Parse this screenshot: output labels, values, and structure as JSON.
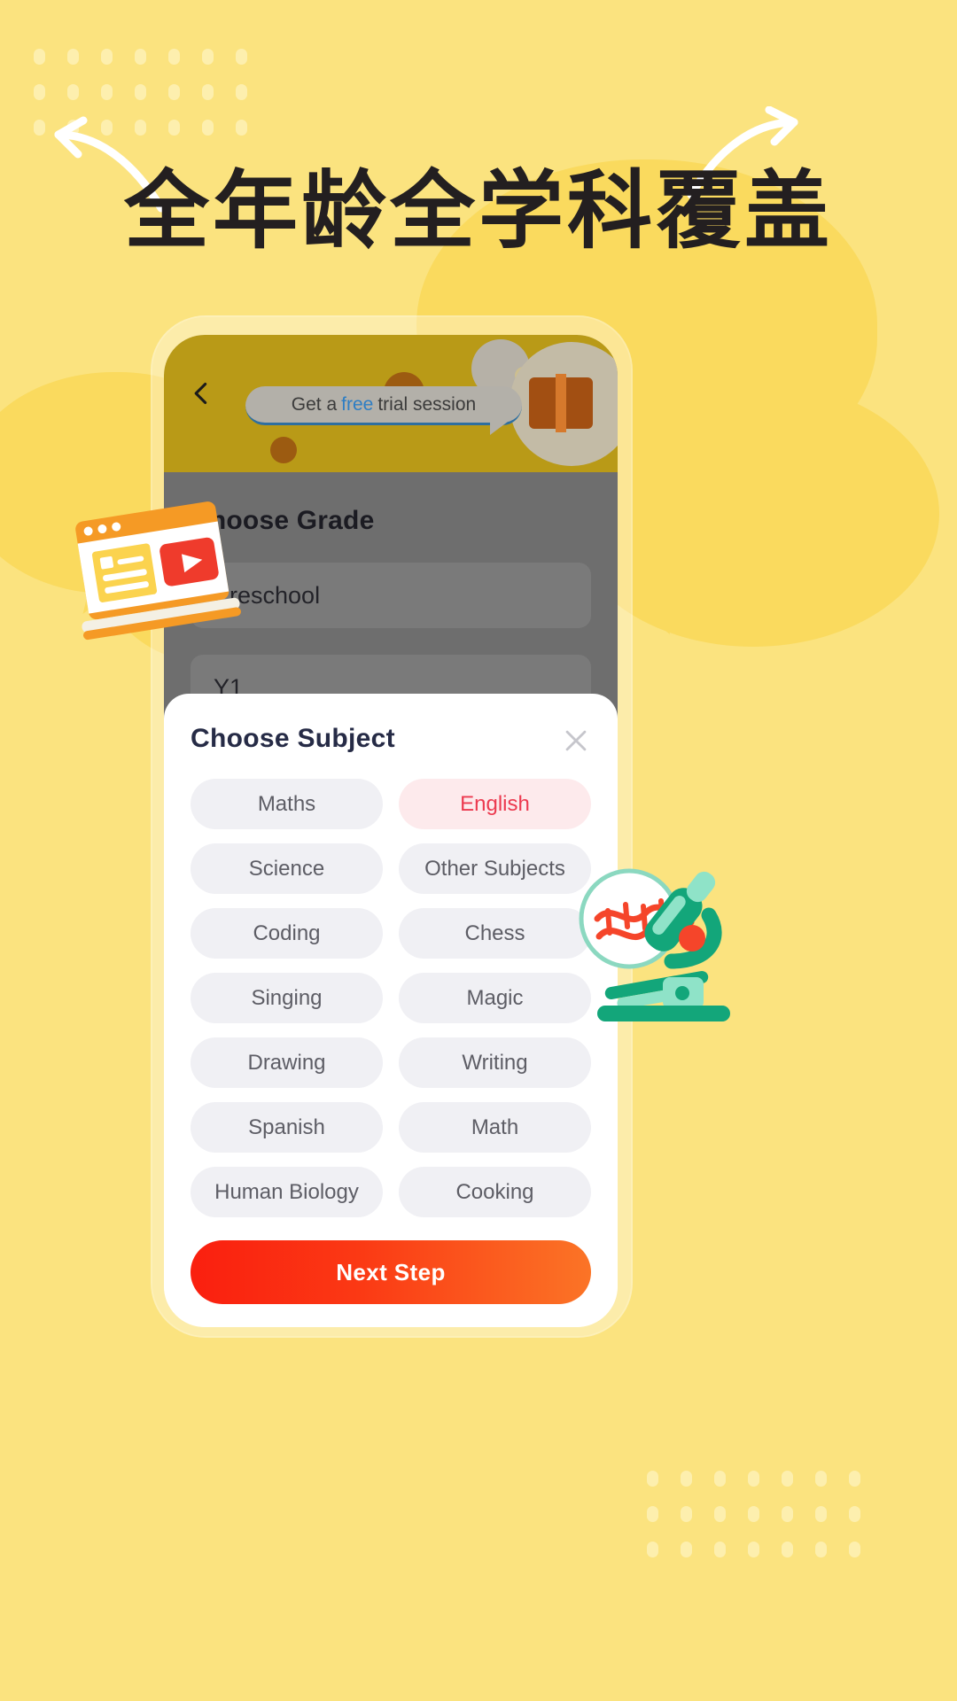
{
  "page": {
    "headline": "全年龄全学科覆盖",
    "background_color": "#fbe37f",
    "accent_color": "#ec3a4f"
  },
  "decor": {
    "arrow_left_name": "curved-arrow-left",
    "arrow_right_name": "curved-arrow-right",
    "laptop_illustration": "video-lesson-laptop-illustration",
    "microscope_illustration": "microscope-dna-illustration"
  },
  "app": {
    "header": {
      "back_icon": "back-chevron-icon",
      "bubble": {
        "prefix": "Get a ",
        "highlight": "free",
        "suffix": " trial session"
      },
      "gift_icon": "gift-icon"
    },
    "grade_section": {
      "title": "Choose Grade",
      "options": [
        "Preschool",
        "Y1"
      ]
    },
    "sheet": {
      "title": "Choose Subject",
      "close_icon": "close-icon",
      "subjects": [
        {
          "label": "Maths",
          "selected": false
        },
        {
          "label": "English",
          "selected": true
        },
        {
          "label": "Science",
          "selected": false
        },
        {
          "label": "Other Subjects",
          "selected": false
        },
        {
          "label": "Coding",
          "selected": false
        },
        {
          "label": "Chess",
          "selected": false
        },
        {
          "label": "Singing",
          "selected": false
        },
        {
          "label": "Magic",
          "selected": false
        },
        {
          "label": "Drawing",
          "selected": false
        },
        {
          "label": "Writing",
          "selected": false
        },
        {
          "label": "Spanish",
          "selected": false
        },
        {
          "label": "Math",
          "selected": false
        },
        {
          "label": "Human Biology",
          "selected": false
        },
        {
          "label": "Cooking",
          "selected": false
        }
      ],
      "next_button": "Next Step"
    }
  }
}
